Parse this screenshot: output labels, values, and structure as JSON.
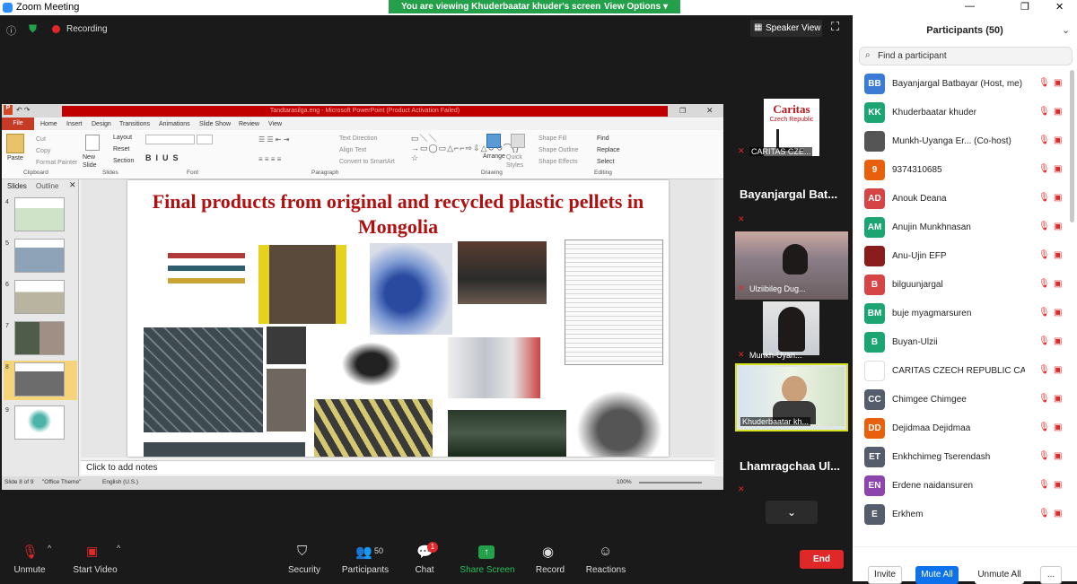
{
  "window": {
    "title": "Zoom Meeting"
  },
  "banner": {
    "viewing": "You are viewing Khuderbaatar khuder's screen",
    "view_options": "View Options"
  },
  "top": {
    "recording": "Recording",
    "speaker_view": "Speaker View"
  },
  "ppt": {
    "title": "Tandtarasilga.eng - Microsoft PowerPoint (Product Activation Failed)",
    "tabs": [
      "File",
      "Home",
      "Insert",
      "Design",
      "Transitions",
      "Animations",
      "Slide Show",
      "Review",
      "View"
    ],
    "groups": {
      "clipboard": "Clipboard",
      "slides": "Slides",
      "font": "Font",
      "paragraph": "Paragraph",
      "drawing": "Drawing",
      "editing": "Editing"
    },
    "buttons": {
      "paste": "Paste",
      "cut": "Cut",
      "copy": "Copy",
      "format_painter": "Format Painter",
      "new_slide": "New Slide",
      "layout": "Layout",
      "reset": "Reset",
      "section": "Section",
      "text_direction": "Text Direction",
      "align_text": "Align Text",
      "convert": "Convert to SmartArt",
      "arrange": "Arrange",
      "quick_styles": "Quick Styles",
      "shape_fill": "Shape Fill",
      "shape_outline": "Shape Outline",
      "shape_effects": "Shape Effects",
      "find": "Find",
      "replace": "Replace",
      "select": "Select"
    },
    "pane_tabs": [
      "Slides",
      "Outline"
    ],
    "thumb_numbers": [
      "4",
      "5",
      "6",
      "7",
      "8",
      "9"
    ],
    "slide_title": "Final products from original and recycled plastic pellets in Mongolia",
    "notes": "Click to add notes",
    "status": {
      "slide": "Slide 8 of 9",
      "theme": "\"Office Theme\"",
      "lang": "English (U.S.)",
      "zoom": "100%"
    }
  },
  "tiles": [
    {
      "name": "CARITAS CZE...",
      "logo": "Caritas",
      "logo_sub": "Czech Republic"
    },
    {
      "name": "Bayanjargal  Bat..."
    },
    {
      "name": "Ulziibileg Dug..."
    },
    {
      "name": "Munkh-Uyan..."
    },
    {
      "name": "Khuderbaatar kh..."
    },
    {
      "name": "Lhamragchaa  Ul..."
    }
  ],
  "toolbar": {
    "unmute": "Unmute",
    "start_video": "Start Video",
    "security": "Security",
    "participants": "Participants",
    "participants_count": "50",
    "chat": "Chat",
    "chat_badge": "1",
    "share_screen": "Share Screen",
    "record": "Record",
    "reactions": "Reactions",
    "end": "End"
  },
  "panel": {
    "title": "Participants (50)",
    "search_placeholder": "Find a participant",
    "participants": [
      {
        "initials": "BB",
        "color": "#3a7bd5",
        "name": "Bayanjargal Batbayar (Host, me)"
      },
      {
        "initials": "KK",
        "color": "#1aa572",
        "name": "Khuderbaatar khuder"
      },
      {
        "initials": "",
        "color": "#555555",
        "name": "Munkh-Uyanga Er...  (Co-host)"
      },
      {
        "initials": "9",
        "color": "#e8600c",
        "name": "9374310685"
      },
      {
        "initials": "AD",
        "color": "#d64545",
        "name": "Anouk Deana"
      },
      {
        "initials": "AM",
        "color": "#1aa572",
        "name": "Anujin Munkhnasan"
      },
      {
        "initials": "",
        "color": "#8a1c1c",
        "name": "Anu-Ujin EFP"
      },
      {
        "initials": "B",
        "color": "#d64545",
        "name": "bilguunjargal"
      },
      {
        "initials": "BM",
        "color": "#1aa572",
        "name": "buje myagmarsuren"
      },
      {
        "initials": "B",
        "color": "#1aa572",
        "name": "Buyan-Ulzii"
      },
      {
        "initials": "",
        "color": "#ffffff",
        "name": "CARITAS CZECH REPUBLIC CARIT..."
      },
      {
        "initials": "CC",
        "color": "#555c6b",
        "name": "Chimgee Chimgee"
      },
      {
        "initials": "DD",
        "color": "#e8600c",
        "name": "Dejidmaa Dejidmaa"
      },
      {
        "initials": "ET",
        "color": "#555c6b",
        "name": "Enkhchimeg Tserendash"
      },
      {
        "initials": "EN",
        "color": "#8e44ad",
        "name": "Erdene naidansuren"
      },
      {
        "initials": "E",
        "color": "#555c6b",
        "name": "Erkhem"
      }
    ],
    "invite": "Invite",
    "mute_all": "Mute All",
    "unmute_all": "Unmute All",
    "more": "..."
  }
}
